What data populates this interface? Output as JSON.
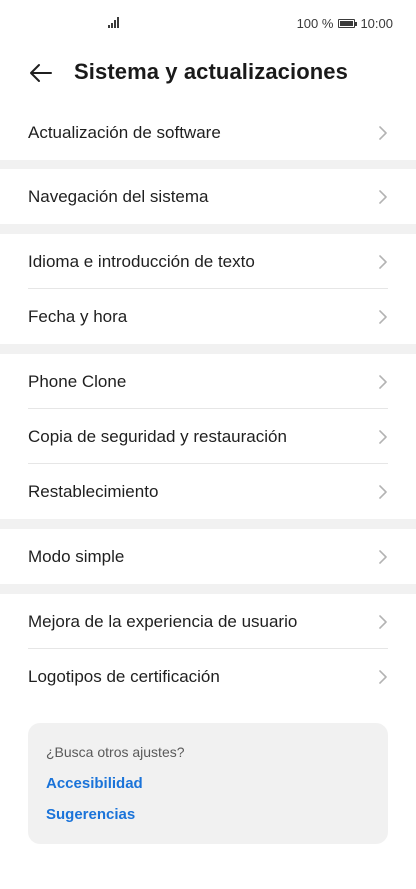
{
  "status_bar": {
    "signal_icon": "signal-bars-icon",
    "battery_text": "100 %",
    "battery_icon": "battery-full-icon",
    "time": "10:00"
  },
  "header": {
    "back_icon": "arrow-left-icon",
    "title": "Sistema y actualizaciones"
  },
  "groups": [
    {
      "items": [
        {
          "label": "Actualización de software"
        }
      ]
    },
    {
      "items": [
        {
          "label": "Navegación del sistema"
        }
      ]
    },
    {
      "items": [
        {
          "label": "Idioma e introducción de texto"
        },
        {
          "label": "Fecha y hora"
        }
      ]
    },
    {
      "items": [
        {
          "label": "Phone Clone"
        },
        {
          "label": "Copia de seguridad y restauración"
        },
        {
          "label": "Restablecimiento"
        }
      ]
    },
    {
      "items": [
        {
          "label": "Modo simple"
        }
      ]
    },
    {
      "items": [
        {
          "label": "Mejora de la experiencia de usuario"
        },
        {
          "label": "Logotipos de certificación"
        }
      ]
    }
  ],
  "suggestions": {
    "title": "¿Busca otros ajustes?",
    "links": [
      {
        "label": "Accesibilidad"
      },
      {
        "label": "Sugerencias"
      }
    ]
  },
  "colors": {
    "background": "#f1f1f1",
    "link": "#1a73d9",
    "chevron": "#b3b3b3"
  }
}
